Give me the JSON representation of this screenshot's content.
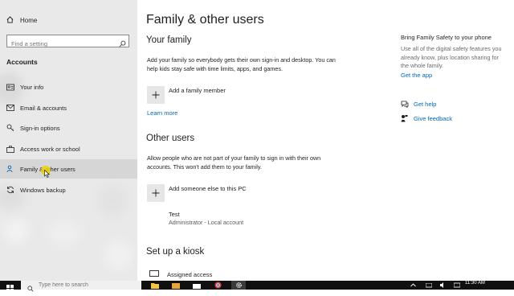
{
  "sidebar": {
    "home_label": "Home",
    "search_placeholder": "Find a setting",
    "section_title": "Accounts",
    "items": [
      {
        "label": "Your info",
        "icon": "person-card-icon"
      },
      {
        "label": "Email & accounts",
        "icon": "mail-icon"
      },
      {
        "label": "Sign-in options",
        "icon": "key-icon"
      },
      {
        "label": "Access work or school",
        "icon": "briefcase-icon"
      },
      {
        "label": "Family & other users",
        "icon": "people-icon",
        "active": true
      },
      {
        "label": "Windows backup",
        "icon": "sync-icon"
      }
    ]
  },
  "main": {
    "title": "Family & other users",
    "your_family": {
      "heading": "Your family",
      "description": "Add your family so everybody gets their own sign-in and desktop. You can help kids stay safe with time limits, apps, and games.",
      "add_label": "Add a family member",
      "learn_more": "Learn more"
    },
    "other_users": {
      "heading": "Other users",
      "description": "Allow people who are not part of your family to sign in with their own accounts. This won't add them to your family.",
      "add_label": "Add someone else to this PC",
      "users": [
        {
          "name": "Test",
          "detail": "Administrator - Local account"
        }
      ]
    },
    "kiosk": {
      "heading": "Set up a kiosk",
      "item_label": "Assigned access"
    }
  },
  "right_panel": {
    "title": "Bring Family Safety to your phone",
    "text": "Use all of the digital safety features you already know, plus location sharing for the whole family.",
    "get_app": "Get the app",
    "get_help": "Get help",
    "give_feedback": "Give feedback"
  },
  "taskbar": {
    "search_placeholder": "Type here to search",
    "time": "11:30 AM"
  },
  "colors": {
    "accent": "#0067b8",
    "sidebar_bg": "#e9e9e9",
    "taskbar_bg": "#101010"
  }
}
